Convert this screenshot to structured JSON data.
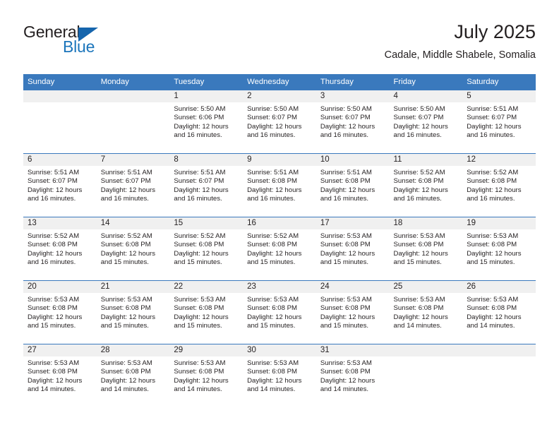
{
  "brand": {
    "name_part1": "General",
    "name_part2": "Blue",
    "accent_color": "#1b75bb",
    "triangle_color": "#1565ad"
  },
  "header": {
    "title": "July 2025",
    "subtitle": "Cadale, Middle Shabele, Somalia"
  },
  "theme": {
    "header_row_bg": "#3a79bd",
    "daynum_band_bg": "#f0f0f0",
    "text_color": "#231f20"
  },
  "weekday_headers": [
    "Sunday",
    "Monday",
    "Tuesday",
    "Wednesday",
    "Thursday",
    "Friday",
    "Saturday"
  ],
  "weeks": [
    [
      {
        "day": "",
        "sunrise": "",
        "sunset": "",
        "daylight_line1": "",
        "daylight_line2": "",
        "empty": true
      },
      {
        "day": "",
        "sunrise": "",
        "sunset": "",
        "daylight_line1": "",
        "daylight_line2": "",
        "empty": true
      },
      {
        "day": "1",
        "sunrise": "Sunrise: 5:50 AM",
        "sunset": "Sunset: 6:06 PM",
        "daylight_line1": "Daylight: 12 hours",
        "daylight_line2": "and 16 minutes."
      },
      {
        "day": "2",
        "sunrise": "Sunrise: 5:50 AM",
        "sunset": "Sunset: 6:07 PM",
        "daylight_line1": "Daylight: 12 hours",
        "daylight_line2": "and 16 minutes."
      },
      {
        "day": "3",
        "sunrise": "Sunrise: 5:50 AM",
        "sunset": "Sunset: 6:07 PM",
        "daylight_line1": "Daylight: 12 hours",
        "daylight_line2": "and 16 minutes."
      },
      {
        "day": "4",
        "sunrise": "Sunrise: 5:50 AM",
        "sunset": "Sunset: 6:07 PM",
        "daylight_line1": "Daylight: 12 hours",
        "daylight_line2": "and 16 minutes."
      },
      {
        "day": "5",
        "sunrise": "Sunrise: 5:51 AM",
        "sunset": "Sunset: 6:07 PM",
        "daylight_line1": "Daylight: 12 hours",
        "daylight_line2": "and 16 minutes."
      }
    ],
    [
      {
        "day": "6",
        "sunrise": "Sunrise: 5:51 AM",
        "sunset": "Sunset: 6:07 PM",
        "daylight_line1": "Daylight: 12 hours",
        "daylight_line2": "and 16 minutes."
      },
      {
        "day": "7",
        "sunrise": "Sunrise: 5:51 AM",
        "sunset": "Sunset: 6:07 PM",
        "daylight_line1": "Daylight: 12 hours",
        "daylight_line2": "and 16 minutes."
      },
      {
        "day": "8",
        "sunrise": "Sunrise: 5:51 AM",
        "sunset": "Sunset: 6:07 PM",
        "daylight_line1": "Daylight: 12 hours",
        "daylight_line2": "and 16 minutes."
      },
      {
        "day": "9",
        "sunrise": "Sunrise: 5:51 AM",
        "sunset": "Sunset: 6:08 PM",
        "daylight_line1": "Daylight: 12 hours",
        "daylight_line2": "and 16 minutes."
      },
      {
        "day": "10",
        "sunrise": "Sunrise: 5:51 AM",
        "sunset": "Sunset: 6:08 PM",
        "daylight_line1": "Daylight: 12 hours",
        "daylight_line2": "and 16 minutes."
      },
      {
        "day": "11",
        "sunrise": "Sunrise: 5:52 AM",
        "sunset": "Sunset: 6:08 PM",
        "daylight_line1": "Daylight: 12 hours",
        "daylight_line2": "and 16 minutes."
      },
      {
        "day": "12",
        "sunrise": "Sunrise: 5:52 AM",
        "sunset": "Sunset: 6:08 PM",
        "daylight_line1": "Daylight: 12 hours",
        "daylight_line2": "and 16 minutes."
      }
    ],
    [
      {
        "day": "13",
        "sunrise": "Sunrise: 5:52 AM",
        "sunset": "Sunset: 6:08 PM",
        "daylight_line1": "Daylight: 12 hours",
        "daylight_line2": "and 16 minutes."
      },
      {
        "day": "14",
        "sunrise": "Sunrise: 5:52 AM",
        "sunset": "Sunset: 6:08 PM",
        "daylight_line1": "Daylight: 12 hours",
        "daylight_line2": "and 15 minutes."
      },
      {
        "day": "15",
        "sunrise": "Sunrise: 5:52 AM",
        "sunset": "Sunset: 6:08 PM",
        "daylight_line1": "Daylight: 12 hours",
        "daylight_line2": "and 15 minutes."
      },
      {
        "day": "16",
        "sunrise": "Sunrise: 5:52 AM",
        "sunset": "Sunset: 6:08 PM",
        "daylight_line1": "Daylight: 12 hours",
        "daylight_line2": "and 15 minutes."
      },
      {
        "day": "17",
        "sunrise": "Sunrise: 5:53 AM",
        "sunset": "Sunset: 6:08 PM",
        "daylight_line1": "Daylight: 12 hours",
        "daylight_line2": "and 15 minutes."
      },
      {
        "day": "18",
        "sunrise": "Sunrise: 5:53 AM",
        "sunset": "Sunset: 6:08 PM",
        "daylight_line1": "Daylight: 12 hours",
        "daylight_line2": "and 15 minutes."
      },
      {
        "day": "19",
        "sunrise": "Sunrise: 5:53 AM",
        "sunset": "Sunset: 6:08 PM",
        "daylight_line1": "Daylight: 12 hours",
        "daylight_line2": "and 15 minutes."
      }
    ],
    [
      {
        "day": "20",
        "sunrise": "Sunrise: 5:53 AM",
        "sunset": "Sunset: 6:08 PM",
        "daylight_line1": "Daylight: 12 hours",
        "daylight_line2": "and 15 minutes."
      },
      {
        "day": "21",
        "sunrise": "Sunrise: 5:53 AM",
        "sunset": "Sunset: 6:08 PM",
        "daylight_line1": "Daylight: 12 hours",
        "daylight_line2": "and 15 minutes."
      },
      {
        "day": "22",
        "sunrise": "Sunrise: 5:53 AM",
        "sunset": "Sunset: 6:08 PM",
        "daylight_line1": "Daylight: 12 hours",
        "daylight_line2": "and 15 minutes."
      },
      {
        "day": "23",
        "sunrise": "Sunrise: 5:53 AM",
        "sunset": "Sunset: 6:08 PM",
        "daylight_line1": "Daylight: 12 hours",
        "daylight_line2": "and 15 minutes."
      },
      {
        "day": "24",
        "sunrise": "Sunrise: 5:53 AM",
        "sunset": "Sunset: 6:08 PM",
        "daylight_line1": "Daylight: 12 hours",
        "daylight_line2": "and 15 minutes."
      },
      {
        "day": "25",
        "sunrise": "Sunrise: 5:53 AM",
        "sunset": "Sunset: 6:08 PM",
        "daylight_line1": "Daylight: 12 hours",
        "daylight_line2": "and 14 minutes."
      },
      {
        "day": "26",
        "sunrise": "Sunrise: 5:53 AM",
        "sunset": "Sunset: 6:08 PM",
        "daylight_line1": "Daylight: 12 hours",
        "daylight_line2": "and 14 minutes."
      }
    ],
    [
      {
        "day": "27",
        "sunrise": "Sunrise: 5:53 AM",
        "sunset": "Sunset: 6:08 PM",
        "daylight_line1": "Daylight: 12 hours",
        "daylight_line2": "and 14 minutes."
      },
      {
        "day": "28",
        "sunrise": "Sunrise: 5:53 AM",
        "sunset": "Sunset: 6:08 PM",
        "daylight_line1": "Daylight: 12 hours",
        "daylight_line2": "and 14 minutes."
      },
      {
        "day": "29",
        "sunrise": "Sunrise: 5:53 AM",
        "sunset": "Sunset: 6:08 PM",
        "daylight_line1": "Daylight: 12 hours",
        "daylight_line2": "and 14 minutes."
      },
      {
        "day": "30",
        "sunrise": "Sunrise: 5:53 AM",
        "sunset": "Sunset: 6:08 PM",
        "daylight_line1": "Daylight: 12 hours",
        "daylight_line2": "and 14 minutes."
      },
      {
        "day": "31",
        "sunrise": "Sunrise: 5:53 AM",
        "sunset": "Sunset: 6:08 PM",
        "daylight_line1": "Daylight: 12 hours",
        "daylight_line2": "and 14 minutes."
      },
      {
        "day": "",
        "sunrise": "",
        "sunset": "",
        "daylight_line1": "",
        "daylight_line2": "",
        "empty": true
      },
      {
        "day": "",
        "sunrise": "",
        "sunset": "",
        "daylight_line1": "",
        "daylight_line2": "",
        "empty": true
      }
    ]
  ]
}
